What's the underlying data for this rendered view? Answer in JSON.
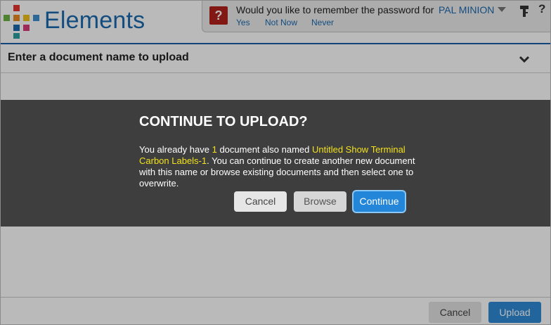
{
  "app": {
    "brand": "Elements",
    "brand_color": "#1b6ab0"
  },
  "password_prompt": {
    "icon": "question-icon",
    "question": "Would you like to remember the password for",
    "account": "PAL MINION",
    "yes": "Yes",
    "not_now": "Not Now",
    "never": "Never"
  },
  "document": {
    "title": "Enter a document name to upload"
  },
  "dialog": {
    "title": "CONTINUE TO UPLOAD?",
    "body_1": "You already have ",
    "count": "1",
    "body_2": " document also named ",
    "doc_name": "Untitled Show Terminal Carbon Labels-1",
    "body_3": ". You can continue to create another new document with this name or browse existing documents and then select one to overwrite.",
    "cancel": "Cancel",
    "browse": "Browse",
    "continue": "Continue"
  },
  "footer": {
    "cancel": "Cancel",
    "upload": "Upload"
  },
  "colors": {
    "accent": "#2486d8",
    "highlight": "#f2e11c",
    "dialog_bg": "#3e3e3e"
  }
}
